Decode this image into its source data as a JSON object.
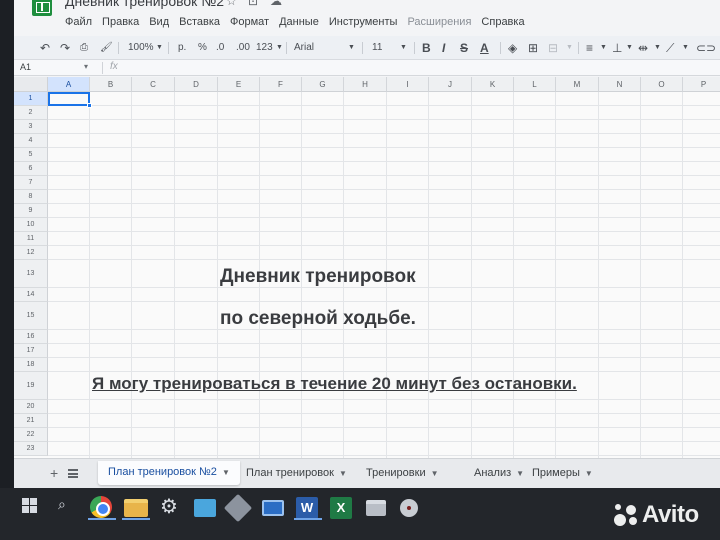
{
  "window": {
    "title": "Дневник тренировок №2",
    "icons": [
      "star-icon",
      "move-icon",
      "cloud-icon"
    ]
  },
  "menu": [
    "Файл",
    "Правка",
    "Вид",
    "Вставка",
    "Формат",
    "Данные",
    "Инструменты",
    "Расширения",
    "Справка"
  ],
  "toolbar": {
    "zoom": "100%",
    "currency": "р.",
    "percent": "%",
    "decimal_decrease": ".0",
    "decimal_increase": ".00",
    "number_format": "123",
    "font": "Arial",
    "font_size": "11",
    "bold": "B",
    "italic": "I",
    "strikethrough": "S",
    "text_color": "A"
  },
  "formula_bar": {
    "cell_ref": "A1",
    "fx": "fx",
    "value": ""
  },
  "grid": {
    "columns": [
      "A",
      "B",
      "C",
      "D",
      "E",
      "F",
      "G",
      "H",
      "I",
      "J",
      "K",
      "L",
      "M",
      "N",
      "O",
      "P"
    ],
    "rows": [
      "1",
      "2",
      "3",
      "4",
      "5",
      "6",
      "7",
      "8",
      "9",
      "10",
      "11",
      "12",
      "13",
      "14",
      "15",
      "16",
      "17",
      "18",
      "19",
      "20",
      "21",
      "22",
      "23"
    ],
    "selected_cell": "A1",
    "cells": {
      "title_line1": "Дневник тренировок",
      "title_line2": "по северной ходьбе.",
      "statement": "Я могу тренироваться в течение 20 минут без остановки."
    }
  },
  "sheet_tabs": [
    {
      "label": "План тренировок №2",
      "active": true
    },
    {
      "label": "План тренировок",
      "active": false
    },
    {
      "label": "Тренировки",
      "active": false
    },
    {
      "label": "Анализ",
      "active": false
    },
    {
      "label": "Примеры",
      "active": false
    }
  ],
  "taskbar": {
    "word_label": "W",
    "excel_label": "X"
  },
  "watermark": "Avito",
  "colors": {
    "accent": "#1a73e8",
    "sheets_green": "#1e8e3e",
    "text": "#3a3c40"
  }
}
